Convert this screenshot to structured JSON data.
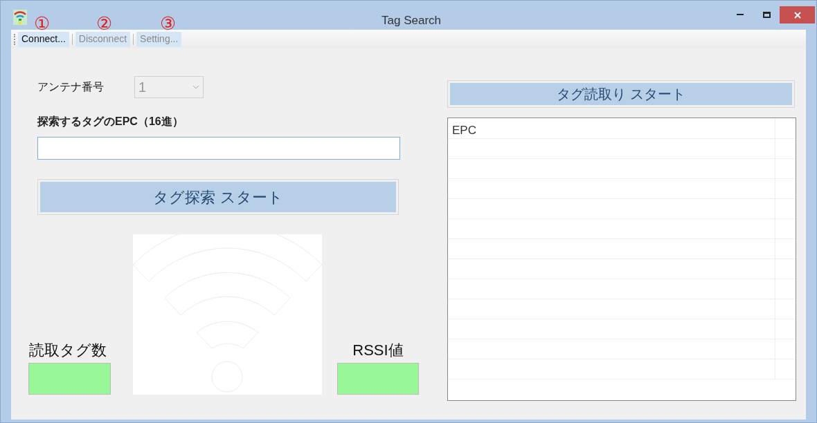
{
  "window": {
    "title": "Tag Search"
  },
  "annotations": [
    "①",
    "②",
    "③"
  ],
  "toolbar": [
    {
      "label": "Connect...",
      "disabled": false
    },
    {
      "label": "Disconnect",
      "disabled": true
    },
    {
      "label": "Setting...",
      "disabled": true
    }
  ],
  "antenna": {
    "label": "アンテナ番号",
    "value": "1",
    "disabled": true
  },
  "epc_field": {
    "label": "探索するタグのEPC（16進）"
  },
  "search_button": "タグ探索 スタート",
  "read_count": {
    "label": "読取タグ数"
  },
  "rssi": {
    "label": "RSSI値"
  },
  "read_button": "タグ読取り スタート",
  "tag_list": {
    "columns": [
      "EPC"
    ]
  }
}
